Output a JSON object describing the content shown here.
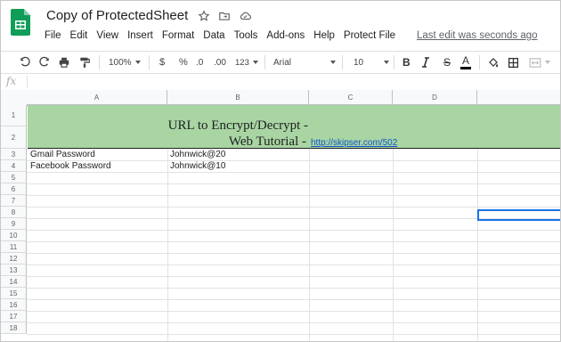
{
  "app": {
    "doc_title": "Copy of ProtectedSheet",
    "last_edit": "Last edit was seconds ago",
    "brand_color": "#0f9d58"
  },
  "menu": [
    "File",
    "Edit",
    "View",
    "Insert",
    "Format",
    "Data",
    "Tools",
    "Add-ons",
    "Help",
    "Protect File"
  ],
  "toolbar": {
    "zoom": "100%",
    "currency": "$",
    "percent": "%",
    "decimal_decrease": ".0",
    "decimal_increase": ".00",
    "more_formats": "123",
    "font": "Arial",
    "font_size": "10",
    "bold": "B",
    "strike": "S",
    "text_color_letter": "A"
  },
  "formula_bar": {
    "fx": "fx",
    "value": ""
  },
  "columns": [
    "A",
    "B",
    "C",
    "D"
  ],
  "rows": [
    "1",
    "2",
    "3",
    "4",
    "5",
    "6",
    "7",
    "8",
    "9",
    "10",
    "11",
    "12",
    "13",
    "14",
    "15",
    "16",
    "17",
    "18"
  ],
  "sheet": {
    "merged_fill": "#a8d5a2",
    "title_line1": "URL to Encrypt/Decrypt -",
    "title_line2": "Web Tutorial -",
    "title_link": "http://skipser.com/502",
    "cells": [
      {
        "a": "Gmail Password",
        "b": "Johnwick@20"
      },
      {
        "a": "Facebook Password",
        "b": "Johnwick@10"
      }
    ],
    "selected_cell": "D8"
  }
}
